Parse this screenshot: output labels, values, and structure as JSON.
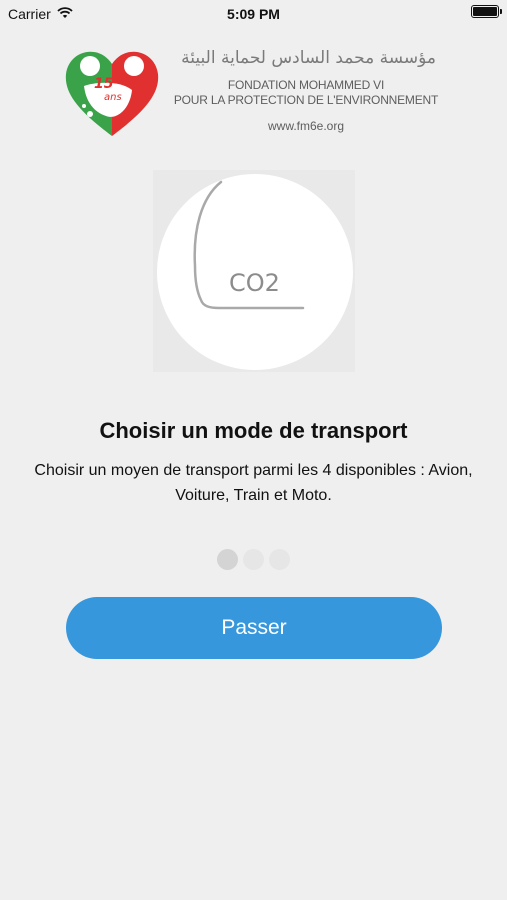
{
  "status_bar": {
    "carrier": "Carrier",
    "time": "5:09 PM",
    "wifi_icon": "wifi-icon",
    "battery_icon": "battery-icon"
  },
  "logo": {
    "arabic_name": "مؤسسة محمد السادس لحماية البيئة",
    "name_line1": "FONDATION MOHAMMED VI",
    "name_line2": "POUR LA PROTECTION DE L'ENVIRONNEMENT",
    "website": "www.fm6e.org",
    "badge_number": "15",
    "badge_word": "ans",
    "colors": {
      "red": "#e0302f",
      "green": "#3aa34a",
      "gray": "#7a7a7a"
    }
  },
  "slide": {
    "icon": "co2-icon",
    "icon_label": "CO2",
    "title": "Choisir un mode de transport",
    "text": "Choisir un moyen de transport parmi les 4 disponibles : Avion, Voiture, Train et Moto."
  },
  "pager": {
    "count": 3,
    "active_index": 0
  },
  "skip_button": {
    "label": "Passer",
    "color": "#3797dc"
  }
}
